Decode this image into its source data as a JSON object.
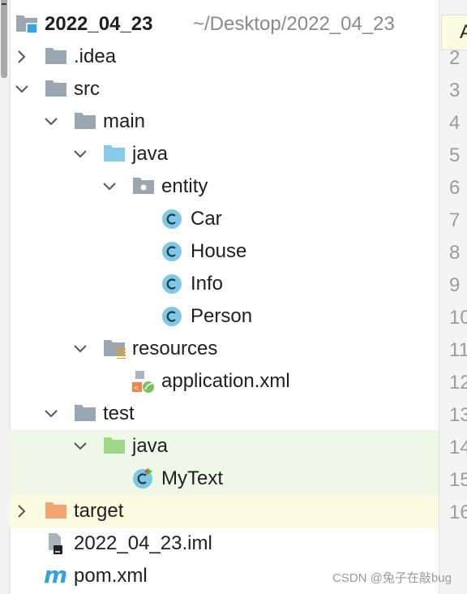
{
  "project": {
    "name": "2022_04_23",
    "path": "~/Desktop/2022_04_23"
  },
  "tree": [
    {
      "label": "2022_04_23",
      "icon": "module-folder-icon",
      "depth": 0,
      "arrow": "none",
      "root": true
    },
    {
      "label": ".idea",
      "icon": "folder-icon",
      "depth": 0,
      "arrow": "collapsed"
    },
    {
      "label": "src",
      "icon": "folder-icon",
      "depth": 0,
      "arrow": "expanded"
    },
    {
      "label": "main",
      "icon": "folder-icon",
      "depth": 1,
      "arrow": "expanded"
    },
    {
      "label": "java",
      "icon": "source-root-folder-icon",
      "depth": 2,
      "arrow": "expanded"
    },
    {
      "label": "entity",
      "icon": "package-icon",
      "depth": 3,
      "arrow": "expanded"
    },
    {
      "label": "Car",
      "icon": "class-icon",
      "depth": 4,
      "arrow": "none"
    },
    {
      "label": "House",
      "icon": "class-icon",
      "depth": 4,
      "arrow": "none"
    },
    {
      "label": "Info",
      "icon": "class-icon",
      "depth": 4,
      "arrow": "none"
    },
    {
      "label": "Person",
      "icon": "class-icon",
      "depth": 4,
      "arrow": "none"
    },
    {
      "label": "resources",
      "icon": "resources-folder-icon",
      "depth": 2,
      "arrow": "expanded"
    },
    {
      "label": "application.xml",
      "icon": "spring-xml-icon",
      "depth": 3,
      "arrow": "none"
    },
    {
      "label": "test",
      "icon": "folder-icon",
      "depth": 1,
      "arrow": "expanded"
    },
    {
      "label": "java",
      "icon": "test-root-folder-icon",
      "depth": 2,
      "arrow": "expanded",
      "highlight": "green"
    },
    {
      "label": "MyText",
      "icon": "test-class-icon",
      "depth": 3,
      "arrow": "none",
      "highlight": "green"
    },
    {
      "label": "target",
      "icon": "excluded-folder-icon",
      "depth": 0,
      "arrow": "collapsed",
      "highlight": "yellow"
    },
    {
      "label": "2022_04_23.iml",
      "icon": "iml-file-icon",
      "depth": 0,
      "arrow": "none"
    },
    {
      "label": "pom.xml",
      "icon": "maven-icon",
      "depth": 0,
      "arrow": "none"
    }
  ],
  "editor_gutter": {
    "top_letter": "A",
    "line_numbers": [
      "2",
      "3",
      "4",
      "5",
      "6",
      "7",
      "8",
      "9",
      "10",
      "11",
      "12",
      "13",
      "14",
      "15",
      "16"
    ]
  },
  "watermark": "CSDN @兔子在敲bug",
  "colors": {
    "folder": "#9aa7b0",
    "source_root": "#87c9e8",
    "test_root": "#9fd787",
    "excluded": "#f4a373",
    "class_circle": "#7ec8e3",
    "green_highlight": "#eff8e6",
    "yellow_highlight": "#fbfbe1",
    "module_badge": "#3aa3dd"
  }
}
